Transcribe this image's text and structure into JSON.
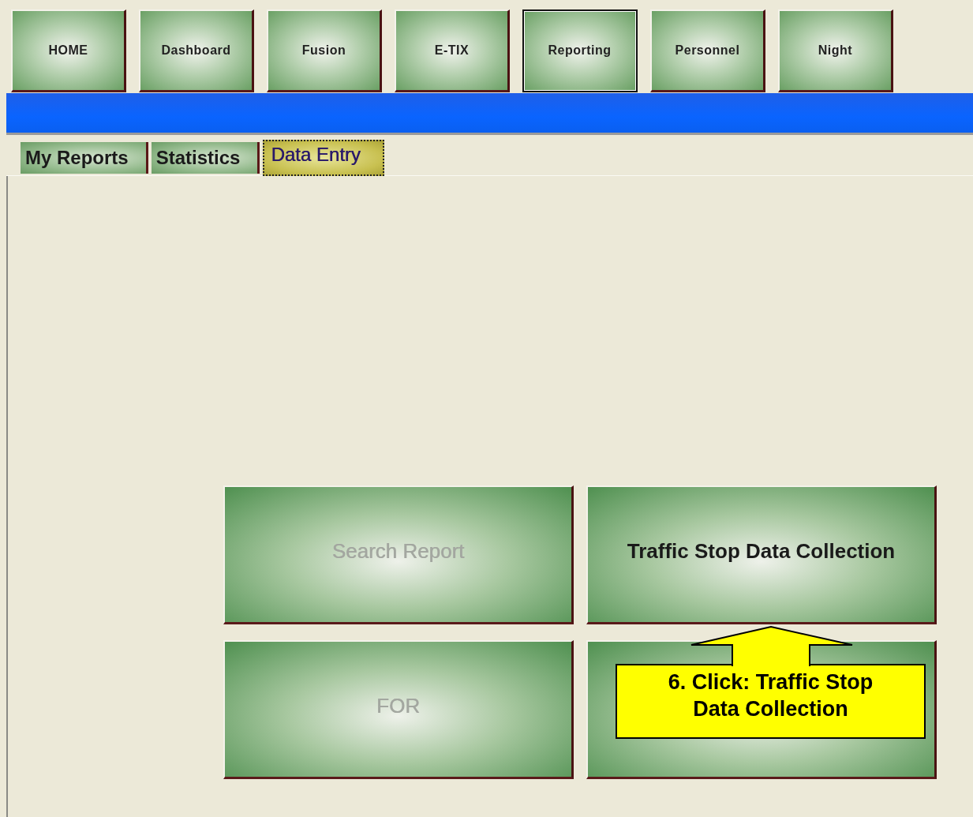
{
  "nav_buttons": [
    {
      "label": "HOME",
      "selected": false
    },
    {
      "label": "Dashboard",
      "selected": false
    },
    {
      "label": "Fusion",
      "selected": false
    },
    {
      "label": "E-TIX",
      "selected": false
    },
    {
      "label": "Reporting",
      "selected": true
    },
    {
      "label": "Personnel",
      "selected": false
    },
    {
      "label": "Night",
      "selected": false
    }
  ],
  "tabs": [
    {
      "label": "My Reports",
      "selected": false
    },
    {
      "label": "Statistics",
      "selected": false
    },
    {
      "label": "Data Entry",
      "selected": true
    }
  ],
  "action_buttons": [
    {
      "kind": "text",
      "label": "Search Report",
      "disabled": true
    },
    {
      "kind": "text",
      "label": "Traffic Stop Data Collection",
      "disabled": false
    },
    {
      "kind": "text",
      "label": "FOR",
      "disabled": true
    },
    {
      "kind": "blank"
    }
  ],
  "callout": {
    "text": "6. Click: Traffic Stop Data Collection"
  }
}
